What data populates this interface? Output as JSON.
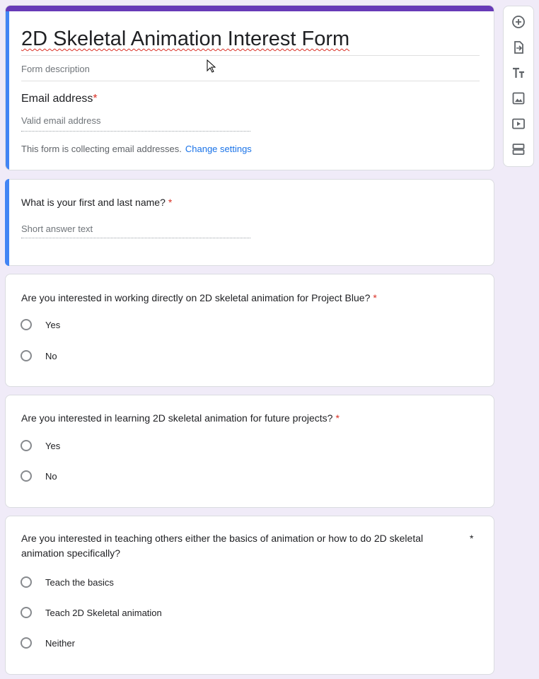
{
  "header": {
    "title": "2D Skeletal Animation Interest Form",
    "description_placeholder": "Form description",
    "email_label": "Email address",
    "email_placeholder": "Valid email address",
    "collect_note": "This form is collecting email addresses.",
    "change_settings": "Change settings"
  },
  "required_mark": "*",
  "questions": [
    {
      "title": "What is your first and last name?",
      "type": "short_answer",
      "placeholder": "Short answer text"
    },
    {
      "title": "Are you interested in working directly on 2D skeletal animation for Project Blue?",
      "type": "multiple_choice",
      "options": [
        "Yes",
        "No"
      ]
    },
    {
      "title": "Are you interested in learning 2D skeletal animation for future projects?",
      "type": "multiple_choice",
      "options": [
        "Yes",
        "No"
      ]
    },
    {
      "title": "Are you interested in teaching others either the basics of animation or how to do 2D skeletal animation specifically?",
      "type": "multiple_choice",
      "options": [
        "Teach the basics",
        "Teach 2D Skeletal animation",
        "Neither"
      ]
    }
  ],
  "toolbar": {
    "icons": [
      "add-question-icon",
      "import-questions-icon",
      "add-title-icon",
      "add-image-icon",
      "add-video-icon",
      "add-section-icon"
    ]
  },
  "colors": {
    "theme": "#673ab7",
    "active_bar": "#4285f4",
    "background": "#f0ebf8",
    "required": "#d93025",
    "link": "#1a73e8"
  }
}
